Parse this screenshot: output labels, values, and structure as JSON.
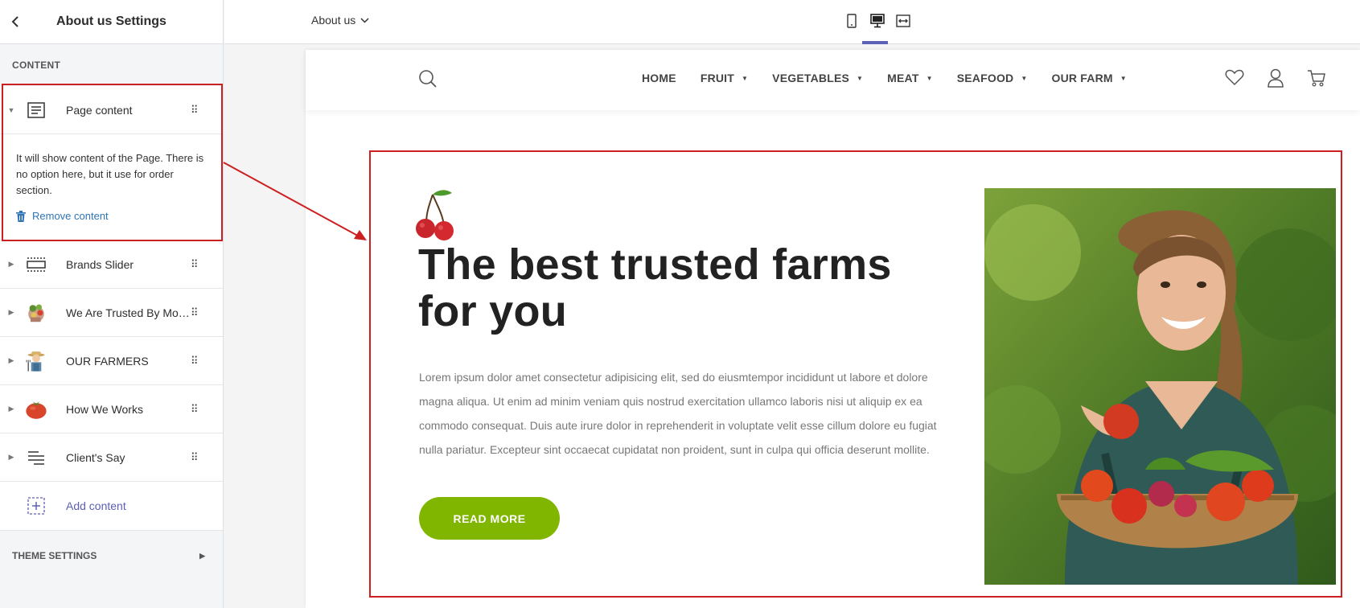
{
  "sidebar": {
    "title": "About us Settings",
    "content_label": "CONTENT",
    "page_content": {
      "label": "Page content",
      "description": "It will show content of the Page. There is no option here, but it use for order section.",
      "remove_label": "Remove content"
    },
    "items": [
      {
        "label": "Brands Slider",
        "icon": "brands-slider-icon"
      },
      {
        "label": "We Are Trusted By Mor...",
        "icon": "vegetables-thumbnail"
      },
      {
        "label": "OUR FARMERS",
        "icon": "farmer-thumbnail"
      },
      {
        "label": "How We Works",
        "icon": "tomato-thumbnail"
      },
      {
        "label": "Client's Say",
        "icon": "list-icon"
      }
    ],
    "add_label": "Add content",
    "theme_settings_label": "THEME SETTINGS"
  },
  "topbar": {
    "page_selector": "About us",
    "devices": [
      "mobile-icon",
      "desktop-icon",
      "full-width-icon"
    ],
    "active_device": "desktop"
  },
  "site": {
    "nav": [
      {
        "label": "HOME",
        "dropdown": false
      },
      {
        "label": "FRUIT",
        "dropdown": true
      },
      {
        "label": "VEGETABLES",
        "dropdown": true
      },
      {
        "label": "MEAT",
        "dropdown": true
      },
      {
        "label": "SEAFOOD",
        "dropdown": true
      },
      {
        "label": "OUR FARM",
        "dropdown": true
      }
    ],
    "hero": {
      "title": "The best trusted farms for you",
      "body": "Lorem ipsum dolor amet consectetur adipisicing elit, sed do eiusmtempor incididunt ut labore et dolore magna aliqua. Ut enim ad minim veniam quis nostrud exercitation ullamco laboris nisi ut aliquip ex ea commodo consequat. Duis aute irure dolor in reprehenderit in voluptate velit esse cillum dolore eu fugiat nulla pariatur. Excepteur sint occaecat cupidatat non proident, sunt in culpa qui officia deserunt mollite.",
      "button": "READ MORE"
    }
  },
  "colors": {
    "accent": "#5c62b8",
    "highlight": "#cc1f1f",
    "button": "#80b500",
    "link": "#2f74b6"
  }
}
